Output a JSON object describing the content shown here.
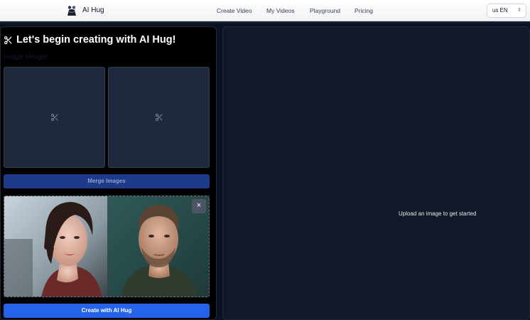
{
  "header": {
    "brand": "AI Hug",
    "nav": [
      "Create Video",
      "My Videos",
      "Playground",
      "Pricing"
    ],
    "language": {
      "flag_code": "us",
      "value": "EN"
    }
  },
  "left": {
    "heading": "Let's begin creating with AI Hug!",
    "section_label": "Image Merger",
    "slot_icons": [
      "scissors-icon",
      "scissors-icon"
    ],
    "merge_button": "Merge Images",
    "close_symbol": "×",
    "create_button": "Create with AI Hug"
  },
  "right": {
    "empty_message": "Upload an image to get started"
  },
  "colors": {
    "primary": "#2563eb",
    "merge": "#1e3a8a",
    "panel": "#111827",
    "slot": "#1e293b"
  }
}
